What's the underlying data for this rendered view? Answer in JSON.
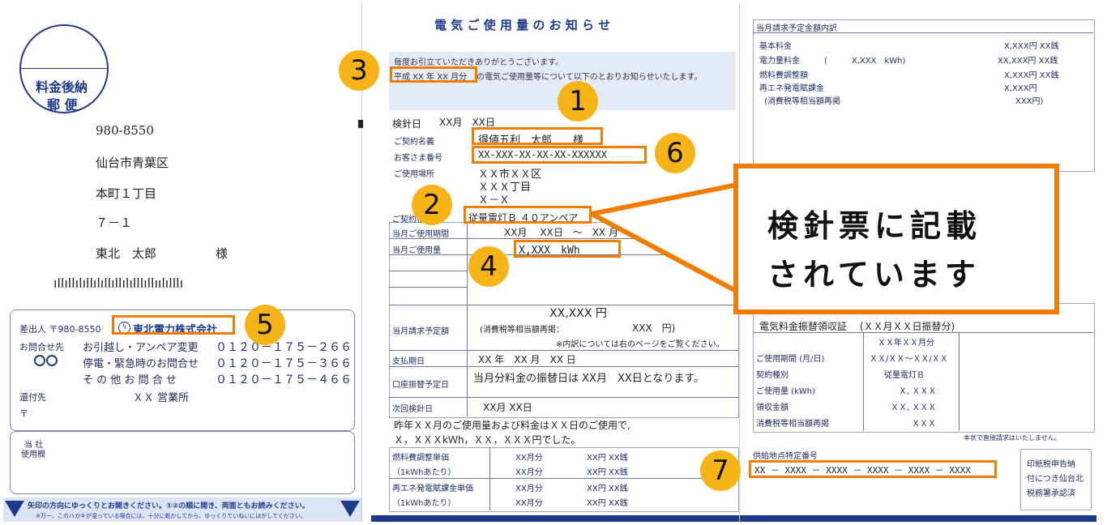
{
  "left_panel": {
    "stamp_line1": "料金後納",
    "stamp_line2": "郵 便",
    "zip": "980-8550",
    "city": "仙台市青葉区",
    "street": "本町１丁目",
    "number": "７－１",
    "recipient": "東北　太郎",
    "honorific": "様",
    "barcode": "ıllıllılıllılıllıllılılllıllıılılllı",
    "sender_label": "差出人 〒980-8550",
    "company": "東北電力株式会社",
    "contact_label": "お問合せ先",
    "contacts": [
      {
        "label": "お引越し・アンペア変更",
        "phone": "０１２０－１７５－２６６"
      },
      {
        "label": "停電・緊急時のお問合せ",
        "phone": "０１２０－１７５－３６６"
      },
      {
        "label": "そ の 他 お 問 合 せ",
        "phone": "０１２０－１７５－４６６"
      }
    ],
    "return_label": "還付先",
    "office": "ＸＸ 営業所",
    "postal_mark": "〒",
    "company_use_1": "当 社",
    "company_use_2": "使用欄",
    "bottom_note1": "矢印の方向にゆっくりとお開きください。①②の順に開き、両面ともお読みください。",
    "bottom_note2": "※万一、このハガキが湿っている場合には、十分に乾かしてから、ゆっくりていねいにはがしてください。"
  },
  "middle_panel": {
    "title": "電 気 ご 使 用 量 の お 知 ら せ",
    "greeting1": "毎度お引立ていただきありがとうございます。",
    "greeting_period": "平成 XX 年 XX 月分",
    "greeting2": "の電気ご使用量等について以下のとおりお知らせいたします。",
    "meter_date_label": "検針日",
    "meter_date": "XX月　XX日",
    "contract_name_label": "ご契約名義",
    "contract_name": "得値五利　太郎　　様",
    "customer_no_label": "お客さま番号",
    "customer_no": "XX-XXX-XX-XX-XX-XXXXXX",
    "location_label": "ご使用場所",
    "location1": "ＸＸ市ＸＸ区",
    "location2": "ＸＸＸ丁目",
    "location3": "Ｘ－Ｘ",
    "contract_type_label": "ご契約種別",
    "contract_type": "従量電灯Ｂ ４０アンペア",
    "period_label": "当月ご使用期間",
    "period_value": "XX月　 XX日　～　XX 月　XX",
    "usage_label": "当月ご使用量",
    "usage_value": "X,XXX　kWh",
    "billing_label": "当月請求予定額",
    "billing_value": "XX,XXX 円",
    "tax_note": "(消費税等相当額再掲：",
    "tax_value": "XXX　円)",
    "breakdown_note": "※内訳については右のページをご覧ください。",
    "payment_date_label": "支払期日",
    "payment_date": "XX 年　XX 月　XX 日",
    "transfer_label": "口座振替予定日",
    "transfer_text": "当月分料金の振替日は XX月　XX日となります。",
    "next_meter_label": "次回検針日",
    "next_meter": "XX月 XX日",
    "last_year1": "昨年ＸＸ月のご使用量および料金はＸＸ日のご使用で,",
    "last_year2": "Ｘ，ＸＸＸkＷh，ＸＸ，ＸＸＸ円でした。",
    "fuel_label1": "燃料費調整単価",
    "fuel_label2": "（1kＷhあたり）",
    "renew_label1": "再エネ発電賦課金単価",
    "renew_label2": "（1kＷhあたり）",
    "unit_month": "XX月分",
    "unit_price": "XX円 XX銭"
  },
  "right_panel": {
    "header": "当月請求予定金額内訳",
    "rows": [
      {
        "label": "基本料金",
        "mid": "",
        "value": "X,XXX円 XX銭"
      },
      {
        "label": "電力量料金",
        "mid": "(　　　X,XXX　kWh)",
        "value": "XX,XXX円 XX銭"
      },
      {
        "label": "燃料費調整額",
        "mid": "",
        "value": "X,XXX円 XX銭"
      },
      {
        "label": "再エネ発電賦課金",
        "mid": "",
        "value": "X,XXX円"
      },
      {
        "label": "(消費税等相当額再掲",
        "mid": "",
        "value": "XXX円)"
      }
    ],
    "receipt_title": "電気料金振替領収証　 (ＸＸ月ＸＸ日振替分)",
    "receipt_month": "ＸＸ年ＸＸ月分",
    "receipt_rows": [
      {
        "label": "ご使用期間 (月/日)",
        "value": "ＸＸ/ＸＸ～ＸＸ/ＸＸ"
      },
      {
        "label": "契約種別",
        "value": "従量電灯Ｂ"
      },
      {
        "label": "ご使用量 (kWh)",
        "value": "Ｘ, ＸＸＸ"
      },
      {
        "label": "領収金額",
        "value": "ＸＸ, ＸＸＸ"
      },
      {
        "label": "消費税等相当額再掲",
        "value": "ＸＸＸ"
      }
    ],
    "no_invoice_note": "本状で直接請求はいたしません。",
    "supply_label": "供給地点特定番号",
    "supply_number": "XX － XXXX － XXXX － XXXX － XXXX － XXXX",
    "stamp_note1": "印紙税申告納",
    "stamp_note2": "付につき仙台北",
    "stamp_note3": "税務署承認済"
  },
  "callout": {
    "line1": "検針票に記載",
    "line2": "されています"
  },
  "markers": [
    "1",
    "2",
    "3",
    "4",
    "5",
    "6",
    "7"
  ],
  "colors": {
    "accent": "#f07d00",
    "marker": "#f6b419",
    "ink": "#1b2a5c",
    "navy": "#1f3a8a"
  }
}
